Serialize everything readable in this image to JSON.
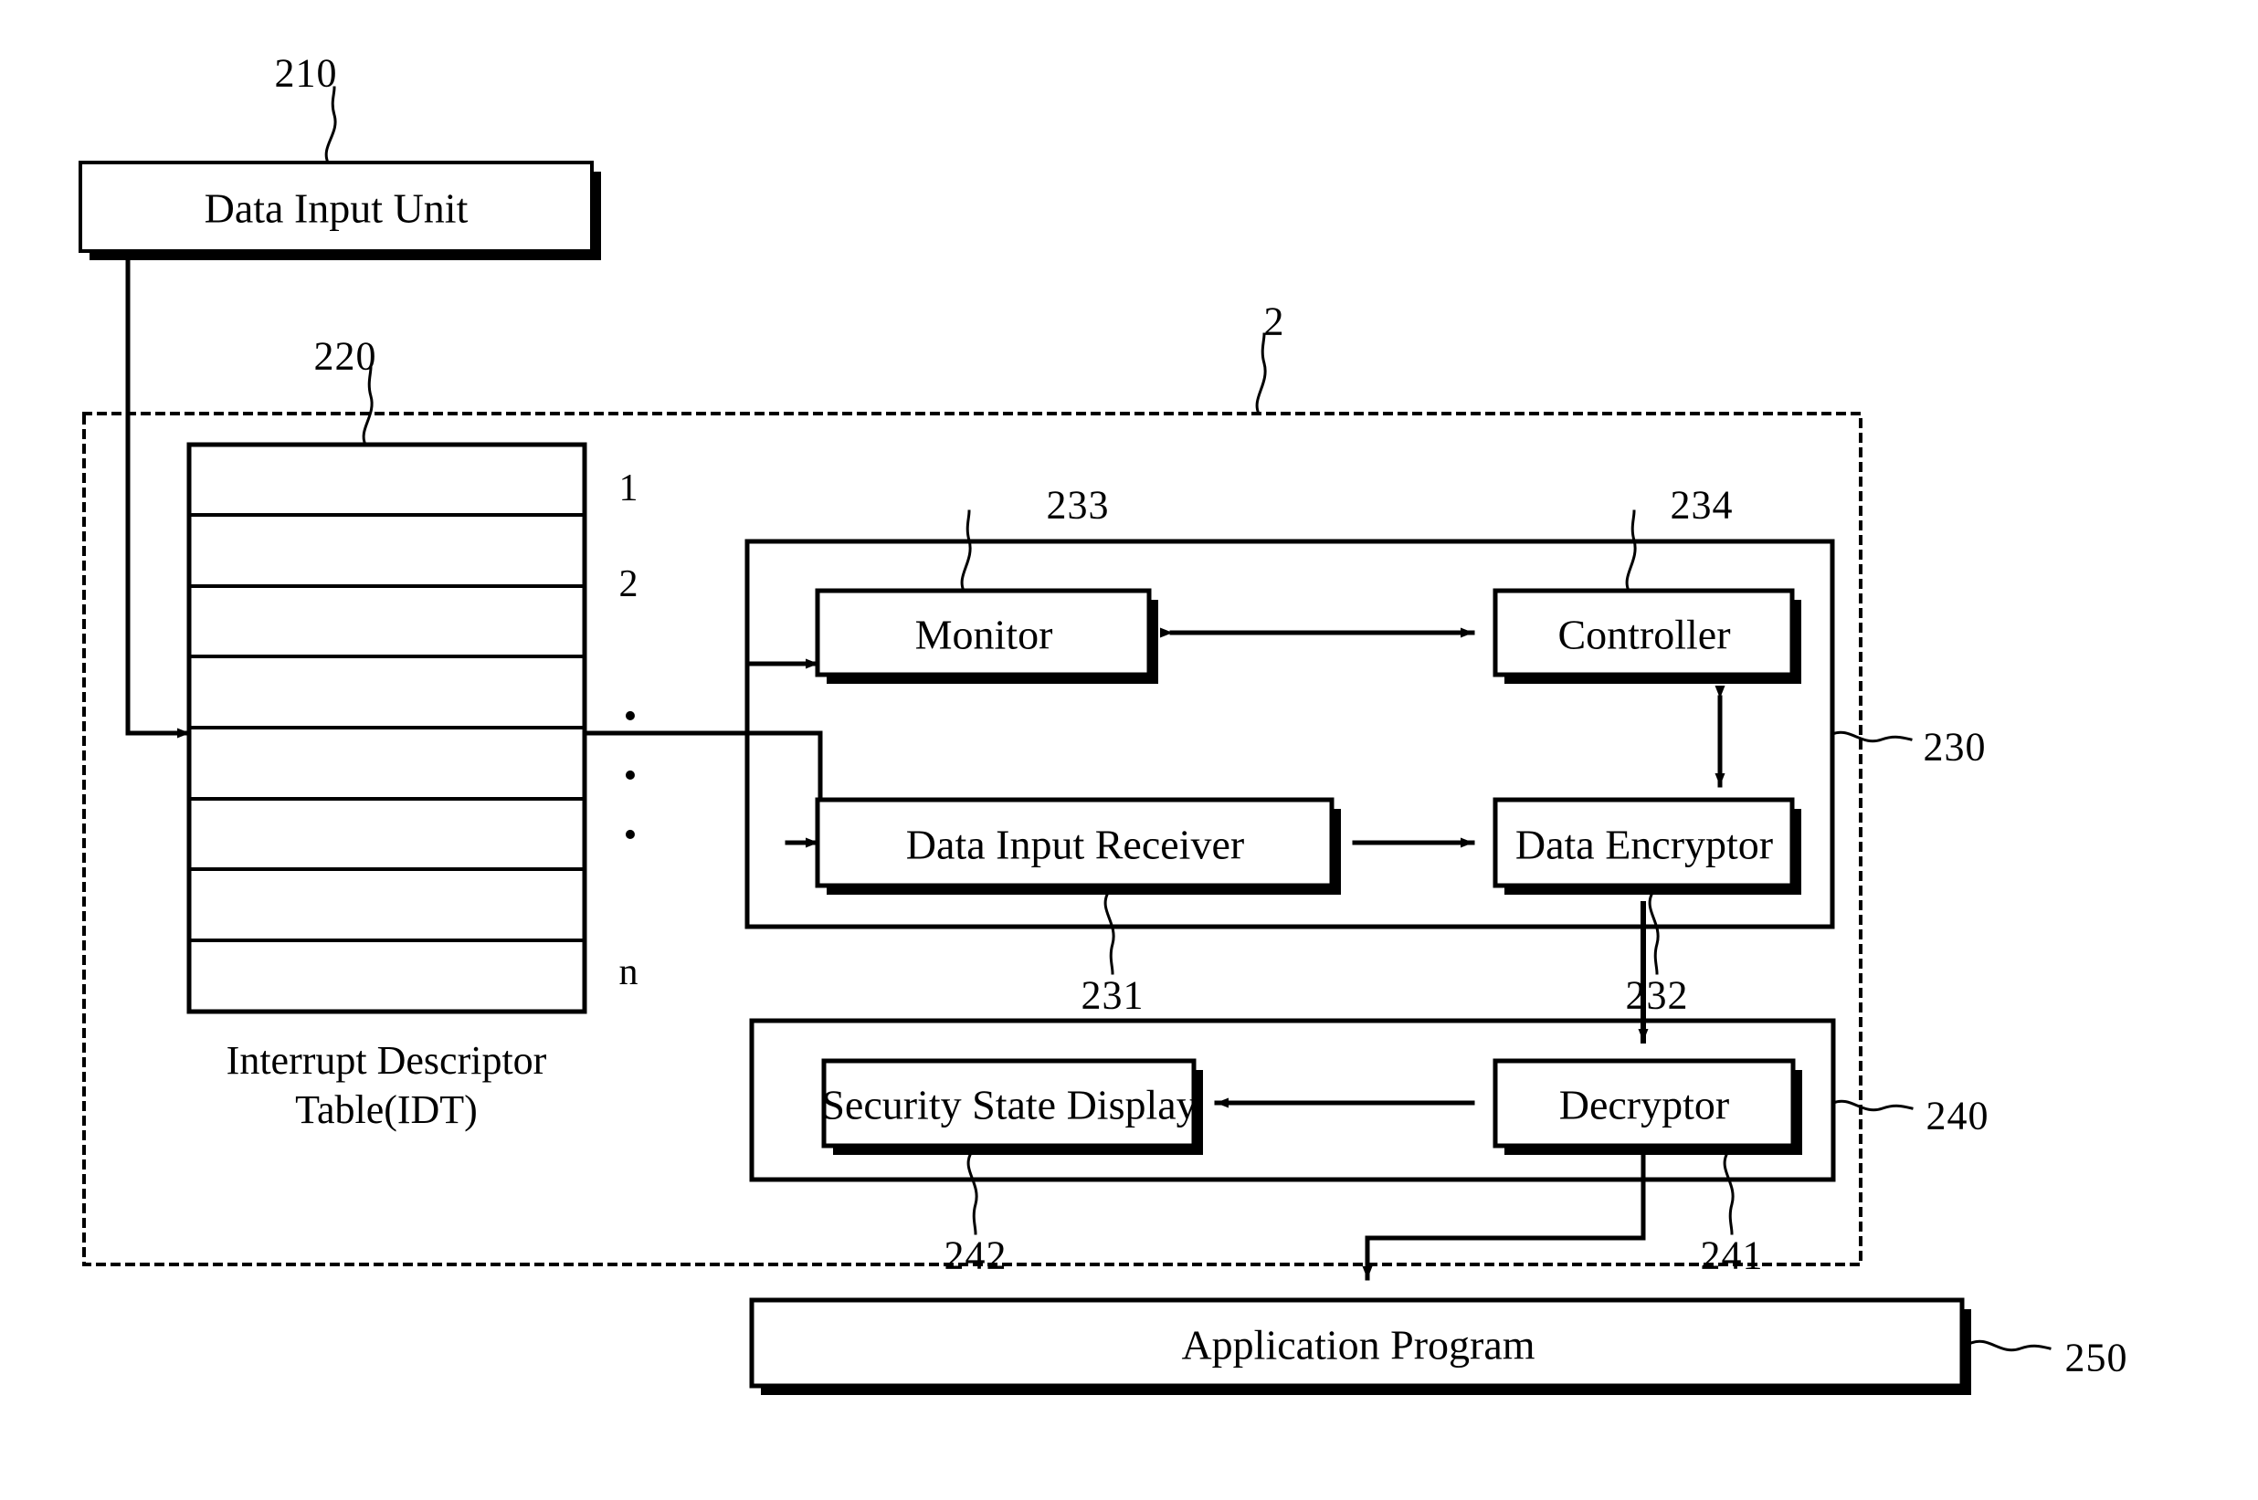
{
  "figure": {
    "type": "patent-block-diagram",
    "system_ref": "2"
  },
  "blocks": [
    {
      "id": "data-input-unit",
      "label": "Data Input Unit",
      "ref": "210"
    },
    {
      "id": "idt",
      "label": "",
      "ref": "220",
      "caption_line1": "Interrupt Descriptor",
      "caption_line2": "Table(IDT)"
    },
    {
      "id": "monitor",
      "label": "Monitor",
      "ref": "233"
    },
    {
      "id": "controller",
      "label": "Controller",
      "ref": "234"
    },
    {
      "id": "data-input-receiver",
      "label": "Data Input Receiver",
      "ref": "231"
    },
    {
      "id": "data-encryptor",
      "label": "Data Encryptor",
      "ref": "232"
    },
    {
      "id": "security-state-display",
      "label": "Security State Display",
      "ref": "242"
    },
    {
      "id": "decryptor",
      "label": "Decryptor",
      "ref": "241"
    },
    {
      "id": "application-program",
      "label": "Application Program",
      "ref": "250"
    }
  ],
  "groups": [
    {
      "id": "secure-input-module",
      "ref": "230"
    },
    {
      "id": "secure-output-module",
      "ref": "240"
    }
  ],
  "idt_rows": [
    {
      "index": 1,
      "label": "1"
    },
    {
      "index": 2,
      "label": "2"
    },
    {
      "index": 3,
      "label": ""
    },
    {
      "index": 4,
      "label": "•"
    },
    {
      "index": 5,
      "label": "•"
    },
    {
      "index": 6,
      "label": "•"
    },
    {
      "index": 7,
      "label": ""
    },
    {
      "index": 8,
      "label": "n"
    }
  ],
  "refs": {
    "r210": "210",
    "r220": "220",
    "r230": "230",
    "r231": "231",
    "r232": "232",
    "r233": "233",
    "r234": "234",
    "r240": "240",
    "r241": "241",
    "r242": "242",
    "r250": "250",
    "r2": "2"
  },
  "labels": {
    "data_input_unit": "Data Input Unit",
    "monitor": "Monitor",
    "controller": "Controller",
    "data_input_receiver": "Data Input Receiver",
    "data_encryptor": "Data Encryptor",
    "security_state_display": "Security State Display",
    "decryptor": "Decryptor",
    "application_program": "Application Program",
    "idt_caption_1": "Interrupt Descriptor",
    "idt_caption_2": "Table(IDT)",
    "row1": "1",
    "row2": "2",
    "rown": "n",
    "dot": "•"
  },
  "colors": {
    "stroke": "#000000",
    "background": "#ffffff"
  }
}
